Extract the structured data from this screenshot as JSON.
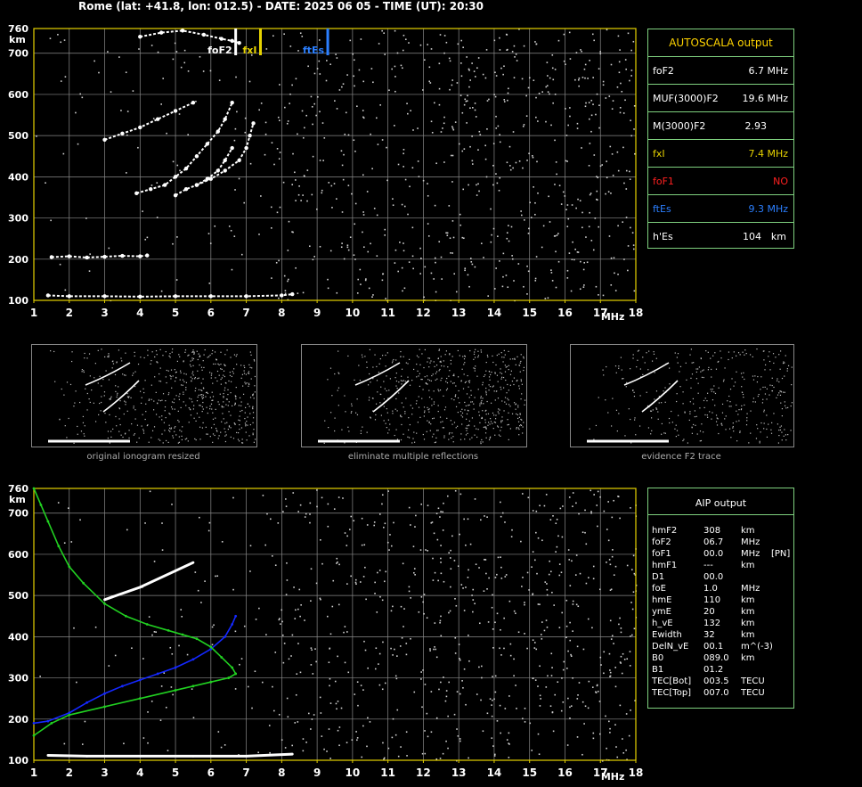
{
  "header": "Rome (lat: +41.8, lon: 012.5) - DATE: 2025 06 05 - TIME (UT): 20:30",
  "colors": {
    "axis": "#e6d200",
    "grid": "#8a8a8a",
    "panel_border": "#7fd07f",
    "fxI": "#e6d200",
    "foF1": "#ff2020",
    "ftEs": "#2b7fff",
    "profile": "#1428ff",
    "model": "#21d121"
  },
  "chart_data": [
    {
      "type": "scatter",
      "title": "",
      "xlabel": "MHz",
      "ylabel": "km",
      "xlim": [
        1,
        18
      ],
      "ylim": [
        100,
        760
      ],
      "xticks": [
        "1",
        "2",
        "3",
        "4",
        "5",
        "6",
        "7",
        "8",
        "9",
        "10",
        "11",
        "12",
        "13",
        "14",
        "15",
        "16",
        "17",
        "18"
      ],
      "yticks": [
        "100",
        "200",
        "300",
        "400",
        "500",
        "600",
        "700",
        "760"
      ],
      "grid": true,
      "markers": [
        {
          "label": "foF2",
          "x": 6.7,
          "color": "#ffffff"
        },
        {
          "label": "fxI",
          "x": 7.4,
          "color": "#e6d200"
        },
        {
          "label": "ftEs",
          "x": 9.3,
          "color": "#2b7fff"
        }
      ],
      "traces": [
        {
          "name": "",
          "x": [
            1.4,
            2.0,
            3.0,
            4.0,
            5.0,
            6.0,
            7.0,
            8.0,
            8.3
          ],
          "y": [
            112,
            110,
            110,
            109,
            110,
            110,
            110,
            112,
            115
          ]
        },
        {
          "name": "",
          "x": [
            1.5,
            2.0,
            2.5,
            3.0,
            3.5,
            4.0,
            4.2
          ],
          "y": [
            205,
            207,
            204,
            206,
            208,
            207,
            209
          ]
        },
        {
          "name": "",
          "x": [
            3.0,
            3.5,
            4.0,
            4.5,
            5.0,
            5.5
          ],
          "y": [
            490,
            505,
            520,
            540,
            560,
            580
          ]
        },
        {
          "name": "",
          "x": [
            3.9,
            4.3,
            4.7,
            5.0,
            5.3,
            5.6,
            5.9,
            6.2,
            6.4,
            6.6
          ],
          "y": [
            360,
            370,
            380,
            400,
            420,
            450,
            480,
            510,
            540,
            580
          ]
        },
        {
          "name": "",
          "x": [
            5.0,
            5.3,
            5.6,
            5.9,
            6.2,
            6.4,
            6.6
          ],
          "y": [
            355,
            370,
            380,
            395,
            415,
            440,
            470
          ]
        },
        {
          "name": "",
          "x": [
            5.6,
            6.0,
            6.4,
            6.8,
            7.0,
            7.1,
            7.2
          ],
          "y": [
            380,
            395,
            415,
            440,
            470,
            500,
            530
          ]
        },
        {
          "name": "",
          "x": [
            4.0,
            4.6,
            5.2,
            5.8,
            6.3,
            6.6,
            6.8
          ],
          "y": [
            740,
            750,
            755,
            745,
            735,
            730,
            725
          ]
        }
      ]
    },
    {
      "type": "line",
      "title": "",
      "xlabel": "MHz",
      "ylabel": "km",
      "xlim": [
        1,
        18
      ],
      "ylim": [
        100,
        760
      ],
      "xticks": [
        "1",
        "2",
        "3",
        "4",
        "5",
        "6",
        "7",
        "8",
        "9",
        "10",
        "11",
        "12",
        "13",
        "14",
        "15",
        "16",
        "17",
        "18"
      ],
      "yticks": [
        "100",
        "200",
        "300",
        "400",
        "500",
        "600",
        "700",
        "760"
      ],
      "grid": true,
      "series": [
        {
          "name": "",
          "color": "#1428ff",
          "x": [
            1.0,
            1.4,
            2.0,
            2.5,
            3.0,
            3.5,
            4.0,
            4.5,
            5.0,
            5.5,
            6.0,
            6.4,
            6.6,
            6.7
          ],
          "y": [
            190,
            195,
            215,
            240,
            262,
            280,
            295,
            310,
            325,
            345,
            370,
            400,
            430,
            450
          ]
        },
        {
          "name": "",
          "color": "#21d121",
          "x": [
            1.0,
            1.2,
            1.4,
            1.7,
            2.0,
            2.4,
            3.0,
            3.6,
            4.2,
            4.8,
            5.2,
            5.6,
            6.0,
            6.3,
            6.6,
            6.7,
            6.5,
            6.0,
            5.5,
            5.0,
            4.0,
            3.0,
            2.0,
            1.5,
            1.0
          ],
          "y": [
            760,
            720,
            680,
            620,
            570,
            530,
            480,
            450,
            430,
            415,
            405,
            395,
            375,
            350,
            325,
            310,
            300,
            290,
            280,
            270,
            250,
            230,
            210,
            190,
            160
          ]
        },
        {
          "name": "",
          "color": "#ffffff",
          "x": [
            1.4,
            2.5,
            4.0,
            5.5,
            7.0,
            8.3
          ],
          "y": [
            112,
            110,
            110,
            110,
            110,
            115
          ]
        },
        {
          "name": "",
          "color": "#ffffff",
          "x": [
            3.0,
            4.0,
            5.0,
            5.5
          ],
          "y": [
            490,
            520,
            560,
            580
          ]
        }
      ]
    }
  ],
  "autoscala": {
    "title": "AUTOSCALA output",
    "rows": [
      {
        "name": "foF2",
        "value": "6.7 MHz",
        "name_color": "#ffffff",
        "value_color": "#ffffff"
      },
      {
        "name": "MUF(3000)F2",
        "value": "19.6 MHz",
        "name_color": "#ffffff",
        "value_color": "#ffffff"
      },
      {
        "name": "M(3000)F2",
        "value": "2.93",
        "name_color": "#ffffff",
        "value_color": "#ffffff"
      },
      {
        "name": "fxI",
        "value": "7.4 MHz",
        "name_color": "#e6d200",
        "value_color": "#e6d200"
      },
      {
        "name": "foF1",
        "value": "NO",
        "name_color": "#ff2020",
        "value_color": "#ff2020"
      },
      {
        "name": "ftEs",
        "value": "9.3 MHz",
        "name_color": "#2b7fff",
        "value_color": "#2b7fff"
      },
      {
        "name": "h'Es",
        "value": "104",
        "unit": "km",
        "name_color": "#ffffff",
        "value_color": "#ffffff"
      }
    ]
  },
  "thumbnails": [
    {
      "caption": "original ionogram resized"
    },
    {
      "caption": "eliminate multiple reflections"
    },
    {
      "caption": "evidence F2 trace"
    }
  ],
  "aip": {
    "title": "AIP output",
    "rows": [
      {
        "name": "hmF2",
        "value": "308",
        "unit": "km",
        "extra": ""
      },
      {
        "name": "foF2",
        "value": "06.7",
        "unit": "MHz",
        "extra": ""
      },
      {
        "name": "foF1",
        "value": "00.0",
        "unit": "MHz",
        "extra": "[PN]"
      },
      {
        "name": "hmF1",
        "value": "---",
        "unit": "km",
        "extra": ""
      },
      {
        "name": "D1",
        "value": "00.0",
        "unit": "",
        "extra": ""
      },
      {
        "name": "foE",
        "value": "1.0",
        "unit": "MHz",
        "extra": ""
      },
      {
        "name": "hmE",
        "value": "110",
        "unit": "km",
        "extra": ""
      },
      {
        "name": "ymE",
        "value": "20",
        "unit": "km",
        "extra": ""
      },
      {
        "name": "h_vE",
        "value": "132",
        "unit": "km",
        "extra": ""
      },
      {
        "name": "Ewidth",
        "value": "32",
        "unit": "km",
        "extra": ""
      },
      {
        "name": "DelN_vE",
        "value": "00.1",
        "unit": "m^(-3)",
        "extra": ""
      },
      {
        "name": "B0",
        "value": "089.0",
        "unit": "km",
        "extra": ""
      },
      {
        "name": "B1",
        "value": "01.2",
        "unit": "",
        "extra": ""
      },
      {
        "name": "TEC[Bot]",
        "value": "003.5",
        "unit": "TECU",
        "extra": ""
      },
      {
        "name": "TEC[Top]",
        "value": "007.0",
        "unit": "TECU",
        "extra": ""
      }
    ]
  }
}
